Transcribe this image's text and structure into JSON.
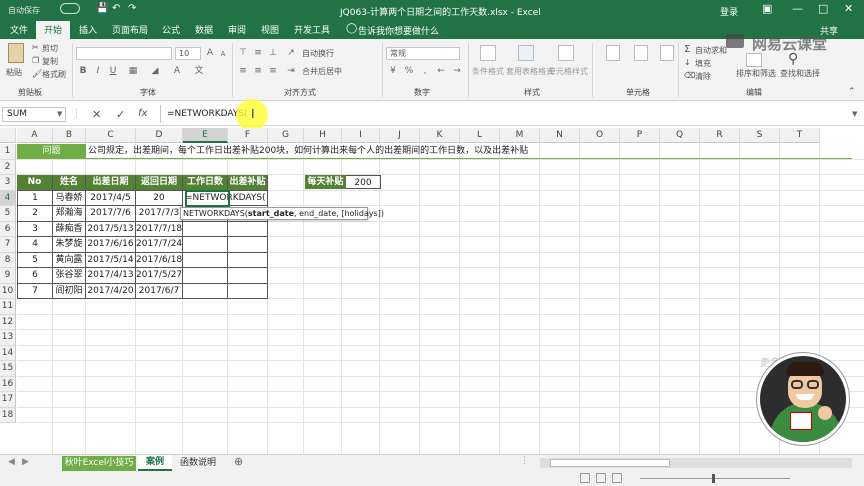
{
  "window": {
    "autosave": "自动保存",
    "title": "JQ063-计算两个日期之间的工作天数.xlsx - Excel",
    "login": "登录",
    "share": "共享",
    "watermark": "网易云课堂"
  },
  "tabs": [
    "文件",
    "开始",
    "插入",
    "页面布局",
    "公式",
    "数据",
    "审阅",
    "视图",
    "开发工具"
  ],
  "tell_me": "告诉我你想要做什么",
  "ribbon": {
    "paste": "粘贴",
    "cut": "剪切",
    "copy": "复制",
    "format_painter": "格式刷",
    "clipboard": "剪贴板",
    "font_size": "10",
    "font": "字体",
    "wrap_text": "自动换行",
    "merge_center": "合并后居中",
    "alignment": "对齐方式",
    "number_format": "常规",
    "number": "数字",
    "conditional_format": "条件格式",
    "format_as_table": "套用表格格式",
    "cell_styles": "单元格样式",
    "styles": "样式",
    "cells": "单元格",
    "autosum": "自动求和",
    "fill": "填充",
    "clear": "清除",
    "sort_filter": "排序和筛选",
    "find_select": "查找和选择",
    "editing": "编辑"
  },
  "formula_bar": {
    "name_box": "SUM",
    "fx": "fx",
    "formula": "=NETWORKDAYS("
  },
  "columns": [
    "A",
    "B",
    "C",
    "D",
    "E",
    "F",
    "G",
    "H",
    "I",
    "J",
    "K",
    "L",
    "M",
    "N",
    "O",
    "P",
    "Q",
    "R",
    "S",
    "T"
  ],
  "rows": [
    "1",
    "2",
    "3",
    "4",
    "5",
    "6",
    "7",
    "8",
    "9",
    "10",
    "11",
    "12",
    "13",
    "14",
    "15",
    "16",
    "17",
    "18"
  ],
  "sheet": {
    "question_label": "问题",
    "question_text": "公司规定，出差期间，每个工作日出差补贴200块，如何计算出来每个人的出差期间的工作日数，以及出差补贴",
    "headers": [
      "No",
      "姓名",
      "出差日期",
      "返回日期",
      "工作日数",
      "出差补贴"
    ],
    "daily_allowance_label": "每天补贴",
    "daily_allowance_value": "200",
    "records": [
      [
        "1",
        "马春娇",
        "2017/4/5",
        "20",
        "=NETWORKDAYS(",
        ""
      ],
      [
        "2",
        "郑瀚海",
        "2017/7/6",
        "2017/7/3",
        "",
        ""
      ],
      [
        "3",
        "薛痴香",
        "2017/5/13",
        "2017/7/18",
        "",
        ""
      ],
      [
        "4",
        "朱梦旋",
        "2017/6/16",
        "2017/7/24",
        "",
        ""
      ],
      [
        "5",
        "黄向露",
        "2017/5/14",
        "2017/6/18",
        "",
        ""
      ],
      [
        "6",
        "张谷翠",
        "2017/4/13",
        "2017/5/27",
        "",
        ""
      ],
      [
        "7",
        "阎初阳",
        "2017/4/20",
        "2017/6/7",
        "",
        ""
      ]
    ],
    "tooltip_prefix": "NETWORKDAYS(",
    "tooltip_arg1": "start_date",
    "tooltip_rest": ", end_date, [holidays])"
  },
  "sheet_tabs": [
    "秋叶Excel小技巧",
    "案例",
    "函数说明"
  ],
  "watermark_faint": "更多好课",
  "colors": {
    "excel_green": "#217346",
    "header_fill": "#548235",
    "question_fill": "#70ad47"
  }
}
